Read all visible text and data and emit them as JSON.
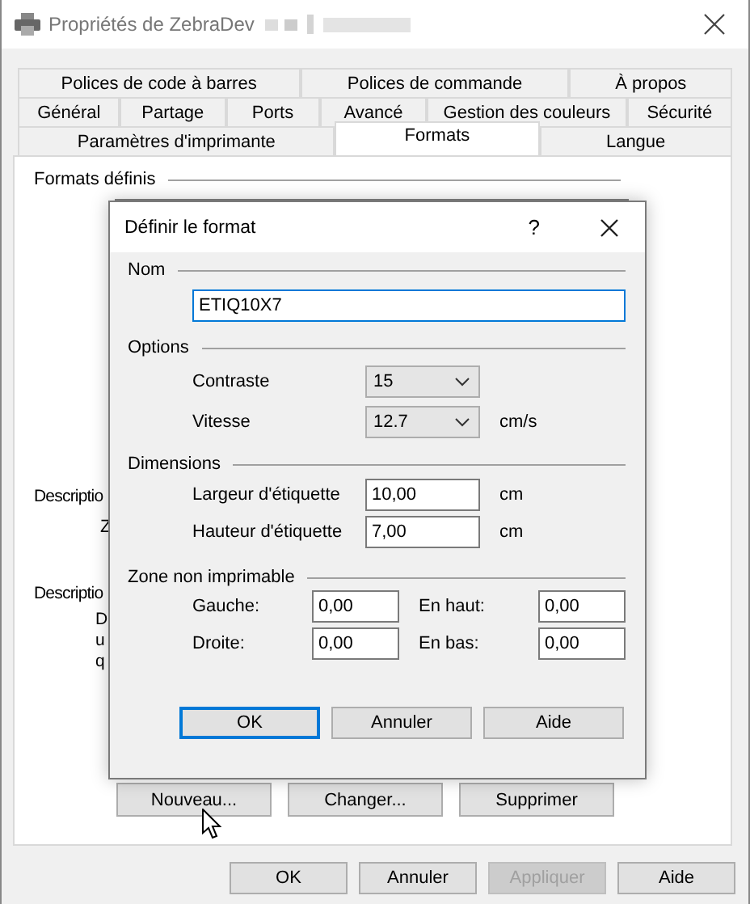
{
  "window": {
    "title": "Propriétés de ZebraDev"
  },
  "tab_rows": [
    {
      "tabs": [
        {
          "label": "Polices de code à barres",
          "selected": false
        },
        {
          "label": "Polices de commande",
          "selected": false
        },
        {
          "label": "À propos",
          "selected": false
        }
      ]
    },
    {
      "tabs": [
        {
          "label": "Général",
          "selected": false
        },
        {
          "label": "Partage",
          "selected": false
        },
        {
          "label": "Ports",
          "selected": false
        },
        {
          "label": "Avancé",
          "selected": false
        },
        {
          "label": "Gestion des couleurs",
          "selected": false
        },
        {
          "label": "Sécurité",
          "selected": false
        }
      ]
    },
    {
      "tabs": [
        {
          "label": "Paramètres d'imprimante",
          "selected": false
        },
        {
          "label": "Formats",
          "selected": true
        },
        {
          "label": "Langue",
          "selected": false
        }
      ]
    }
  ],
  "formats_page": {
    "group_label": "Formats définis",
    "description_label_1": "Descriptio",
    "description_value_1": "Z",
    "description_label_2": "Descriptio",
    "description_lines": [
      "D",
      "u",
      "q"
    ],
    "buttons": [
      {
        "label": "Nouveau..."
      },
      {
        "label": "Changer..."
      },
      {
        "label": "Supprimer"
      }
    ]
  },
  "dialog": {
    "title": "Définir le format",
    "help": "?",
    "name_group": {
      "label": "Nom",
      "value": "ETIQ10X7",
      "focused": true
    },
    "options_group": {
      "label": "Options",
      "rows": [
        {
          "label": "Contraste",
          "value": "15"
        },
        {
          "label": "Vitesse",
          "value": "12.7",
          "unit": "cm/s"
        }
      ]
    },
    "dimensions_group": {
      "label": "Dimensions",
      "rows": [
        {
          "label": "Largeur d'étiquette",
          "value": "10,00",
          "unit": "cm"
        },
        {
          "label": "Hauteur d'étiquette",
          "value": "7,00",
          "unit": "cm"
        }
      ]
    },
    "margins_group": {
      "label": "Zone non imprimable",
      "fields": [
        {
          "label": "Gauche:",
          "value": "0,00"
        },
        {
          "label": "En haut:",
          "value": "0,00"
        },
        {
          "label": "Droite:",
          "value": "0,00"
        },
        {
          "label": "En bas:",
          "value": "0,00"
        }
      ]
    },
    "buttons": [
      {
        "label": "OK",
        "default": true
      },
      {
        "label": "Annuler",
        "default": false
      },
      {
        "label": "Aide",
        "default": false
      }
    ]
  },
  "footer_buttons": [
    {
      "label": "OK",
      "disabled": false
    },
    {
      "label": "Annuler",
      "disabled": false
    },
    {
      "label": "Appliquer",
      "disabled": true
    },
    {
      "label": "Aide",
      "disabled": false
    }
  ]
}
